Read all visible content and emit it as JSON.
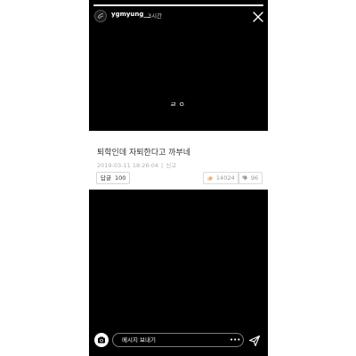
{
  "story": {
    "progress": 1.0,
    "username": "ygmyung__",
    "time_ago": "3시간",
    "center_caption": "ㄹㅇ"
  },
  "post": {
    "title": "퇴학인데 자퇴한다고 까부네",
    "date": "2019-03-11 18:26:04",
    "report_label": "신고",
    "reply_label": "답글",
    "reply_count": "100",
    "likes": "14024",
    "dislikes": "96"
  },
  "footer": {
    "message_placeholder": "메시지 보내기",
    "more_label": "•••"
  },
  "colors": {
    "story_bg": "#000000",
    "card_bg": "#ffffff",
    "page_bg": "#ffffff"
  },
  "icons": [
    "avatar-icon",
    "close-icon",
    "thumbs-up-icon",
    "thumbs-down-icon",
    "camera-icon",
    "send-icon"
  ]
}
